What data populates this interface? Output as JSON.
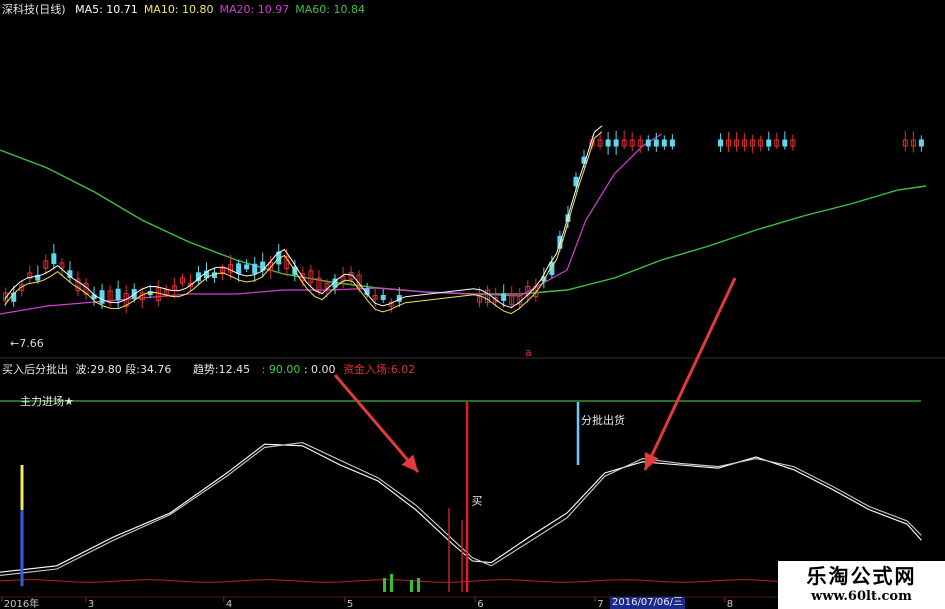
{
  "header": {
    "stock": "深科技(日线)",
    "ma": [
      {
        "label": "MA5:",
        "value": "10.71",
        "color": "#ffffff"
      },
      {
        "label": "MA10:",
        "value": "10.80",
        "color": "#f2e85a"
      },
      {
        "label": "MA20:",
        "value": "10.97",
        "color": "#d040d0"
      },
      {
        "label": "MA60:",
        "value": "10.84",
        "color": "#40c040"
      }
    ]
  },
  "price_panel": {
    "low_marker": "←7.66",
    "marker_char": "a"
  },
  "indicator_header": {
    "name": "买入后分批出",
    "wave_label": "波:",
    "wave_value": "29.80",
    "seg_label": "段:",
    "seg_value": "34.76",
    "trend_label": "趋势:",
    "trend_value": "12.45",
    "v1": ": 90.00",
    "v2": ": 0.00",
    "fund_label": "资金入场:",
    "fund_value": "6.02"
  },
  "indicator_panel": {
    "ref_line_label": "主力进场★",
    "buy_label": "买",
    "sell_label": "分批出货"
  },
  "x_axis": {
    "labels": [
      {
        "text": "2016年",
        "x": 0.4
      },
      {
        "text": "3",
        "x": 9.3
      },
      {
        "text": "4",
        "x": 23.9
      },
      {
        "text": "5",
        "x": 36.7
      },
      {
        "text": "6",
        "x": 50.5
      },
      {
        "text": "7",
        "x": 63.2
      },
      {
        "text": "8",
        "x": 76.9
      }
    ],
    "date_box": "2016/07/06/三"
  },
  "watermark": {
    "title": "乐淘公式网",
    "url": "www.60lt.com"
  },
  "colors": {
    "up": "#e03030",
    "down": "#5fd8ee",
    "ma5": "#ffffff",
    "ma10": "#f2e85a",
    "ma20": "#d040d0",
    "ma60": "#40c040",
    "arrow": "#e03a3a"
  },
  "chart_data": [
    {
      "type": "line",
      "title": "深科技(日线)",
      "x_range": [
        0,
        100
      ],
      "y_range": [
        0,
        100
      ],
      "series": [
        {
          "name": "MA60",
          "x": [
            0,
            5,
            10,
            15,
            20,
            25,
            30,
            35,
            40,
            45,
            50,
            55,
            60,
            65,
            70,
            75,
            80,
            85,
            90,
            95,
            98
          ],
          "y": [
            90,
            81,
            69,
            55,
            44,
            35,
            28,
            24,
            21,
            19,
            18,
            18,
            20,
            26,
            35,
            42,
            50,
            57,
            63,
            70,
            72
          ]
        },
        {
          "name": "MA20",
          "x": [
            0,
            5,
            10,
            15,
            20,
            25,
            30,
            35,
            40,
            45,
            50,
            55,
            60,
            62,
            65,
            68,
            70
          ],
          "y": [
            8,
            12,
            14,
            16,
            18,
            18,
            20,
            20,
            21,
            19,
            18,
            17,
            30,
            55,
            78,
            92,
            98
          ]
        }
      ]
    },
    {
      "type": "line",
      "title": "买入后分批出",
      "x_range": [
        0,
        100
      ],
      "y_range": [
        0,
        100
      ],
      "series": [
        {
          "name": "",
          "x": [
            0,
            6,
            12,
            18,
            24,
            28,
            32,
            36,
            40,
            44,
            48,
            50,
            52,
            56,
            60,
            64,
            68,
            72,
            76,
            80,
            84,
            88,
            92,
            96,
            97.5
          ],
          "y": [
            8,
            12,
            30,
            45,
            70,
            88,
            87,
            75,
            65,
            47,
            25,
            15,
            14,
            30,
            45,
            70,
            77,
            75,
            73,
            80,
            72,
            60,
            47,
            38,
            28
          ]
        },
        {
          "name": "",
          "x": [
            0,
            6,
            12,
            18,
            24,
            28,
            32,
            36,
            40,
            44,
            48,
            50,
            52,
            56,
            60,
            64,
            68,
            72,
            76,
            80,
            84,
            88,
            92,
            96,
            97.5
          ],
          "y": [
            6,
            10,
            28,
            44,
            68,
            86,
            89,
            78,
            67,
            50,
            28,
            17,
            12,
            27,
            42,
            68,
            79,
            76,
            74,
            79,
            74,
            62,
            49,
            40,
            31
          ]
        }
      ]
    }
  ]
}
